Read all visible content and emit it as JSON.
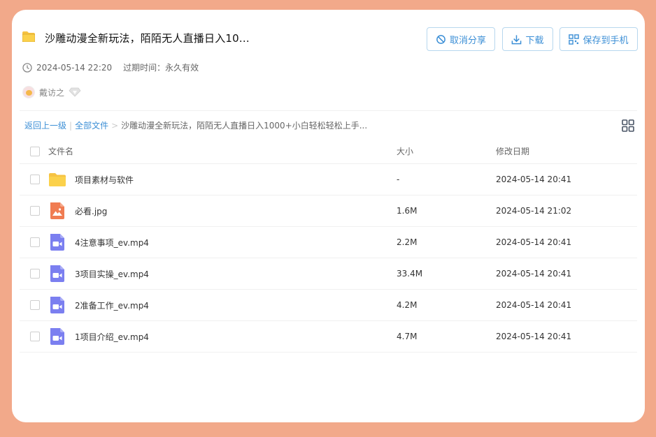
{
  "header": {
    "title": "沙雕动漫全新玩法，陌陌无人直播日入10...",
    "buttons": {
      "cancel_share": "取消分享",
      "download": "下载",
      "save_to_phone": "保存到手机"
    },
    "timestamp": "2024-05-14 22:20",
    "expire": "过期时间：永久有效",
    "user_name": "戴访之"
  },
  "breadcrumb": {
    "back": "返回上一级",
    "sep": "|",
    "all_files": "全部文件",
    "arrow": ">",
    "current": "沙雕动漫全新玩法，陌陌无人直播日入1000+小白轻松轻松上手..."
  },
  "table": {
    "columns": {
      "name": "文件名",
      "size": "大小",
      "date": "修改日期"
    },
    "rows": [
      {
        "name": "项目素材与软件",
        "size": "-",
        "date": "2024-05-14 20:41",
        "icon": "folder-icon"
      },
      {
        "name": "必看.jpg",
        "size": "1.6M",
        "date": "2024-05-14 21:02",
        "icon": "image-file-icon"
      },
      {
        "name": "4注意事项_ev.mp4",
        "size": "2.2M",
        "date": "2024-05-14 20:41",
        "icon": "video-file-icon"
      },
      {
        "name": "3项目实操_ev.mp4",
        "size": "33.4M",
        "date": "2024-05-14 20:41",
        "icon": "video-file-icon"
      },
      {
        "name": "2准备工作_ev.mp4",
        "size": "4.2M",
        "date": "2024-05-14 20:41",
        "icon": "video-file-icon"
      },
      {
        "name": "1项目介绍_ev.mp4",
        "size": "4.7M",
        "date": "2024-05-14 20:41",
        "icon": "video-file-icon"
      }
    ]
  },
  "colors": {
    "background": "#f2a98a",
    "accent": "#3c8fd6",
    "folder": "#fbd14b",
    "image_icon": "#f07c52",
    "video_icon": "#7b7ff0"
  }
}
